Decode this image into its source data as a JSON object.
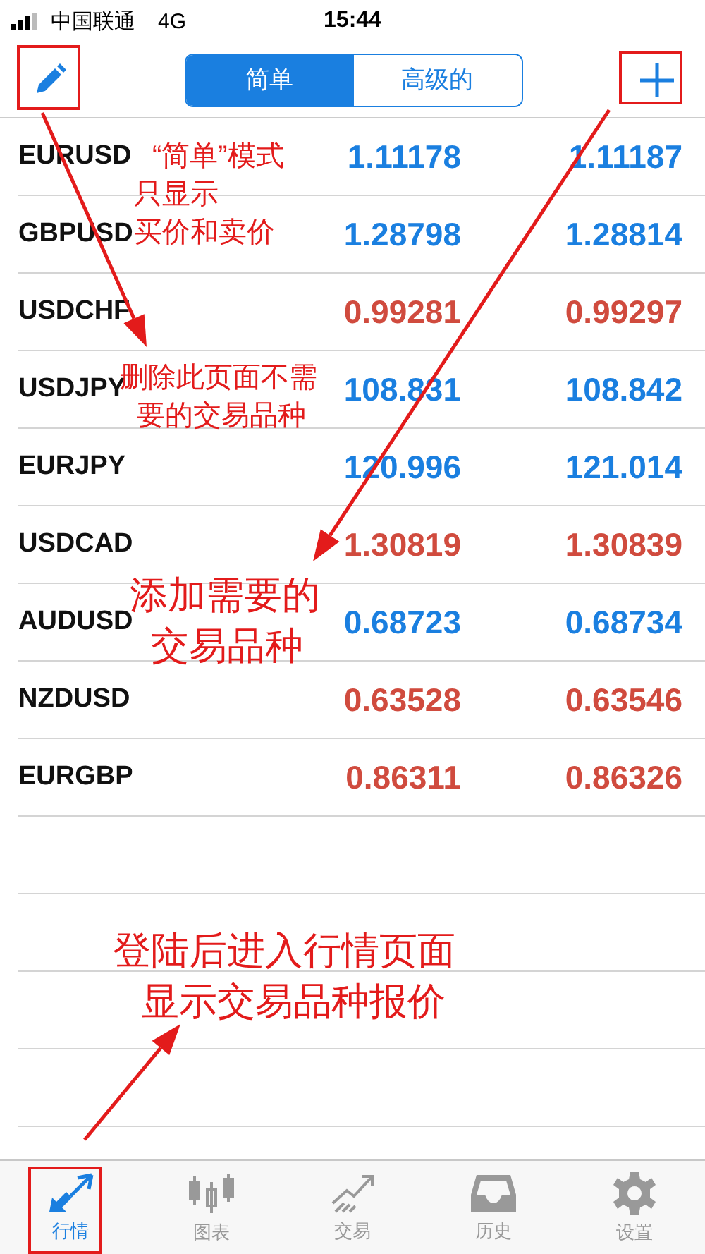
{
  "status_bar": {
    "carrier": "中国联通",
    "network": "4G",
    "time": "15:44"
  },
  "segments": [
    {
      "label": "简单",
      "selected": true
    },
    {
      "label": "高级的",
      "selected": false
    }
  ],
  "quotes": [
    {
      "symbol": "EURUSD",
      "bid": "1.11178",
      "ask": "1.11187",
      "color": "#1a7fe0"
    },
    {
      "symbol": "GBPUSD",
      "bid": "1.28798",
      "ask": "1.28814",
      "color": "#1a7fe0"
    },
    {
      "symbol": "USDCHF",
      "bid": "0.99281",
      "ask": "0.99297",
      "color": "#d04b3e"
    },
    {
      "symbol": "USDJPY",
      "bid": "108.831",
      "ask": "108.842",
      "color": "#1a7fe0"
    },
    {
      "symbol": "EURJPY",
      "bid": "120.996",
      "ask": "121.014",
      "color": "#1a7fe0"
    },
    {
      "symbol": "USDCAD",
      "bid": "1.30819",
      "ask": "1.30839",
      "color": "#d04b3e"
    },
    {
      "symbol": "AUDUSD",
      "bid": "0.68723",
      "ask": "0.68734",
      "color": "#1a7fe0"
    },
    {
      "symbol": "NZDUSD",
      "bid": "0.63528",
      "ask": "0.63546",
      "color": "#d04b3e"
    },
    {
      "symbol": "EURGBP",
      "bid": "0.86311",
      "ask": "0.86326",
      "color": "#d04b3e"
    }
  ],
  "annotations": [
    {
      "lines": [
        "“简单”模式",
        "只显示",
        "买价和卖价"
      ]
    },
    {
      "lines": [
        "删除此页面不需",
        "要的交易品种"
      ]
    },
    {
      "lines": [
        "添加需要的",
        "交易品种"
      ]
    },
    {
      "lines": [
        "登陆后进入行情页面",
        "显示交易品种报价"
      ]
    }
  ],
  "tab_bar": [
    {
      "kind": "quotes",
      "label": "行情",
      "selected": true
    },
    {
      "kind": "chart",
      "label": "图表",
      "selected": false
    },
    {
      "kind": "trade",
      "label": "交易",
      "selected": false
    },
    {
      "kind": "history",
      "label": "历史",
      "selected": false
    },
    {
      "kind": "settings",
      "label": "设置",
      "selected": false
    }
  ]
}
